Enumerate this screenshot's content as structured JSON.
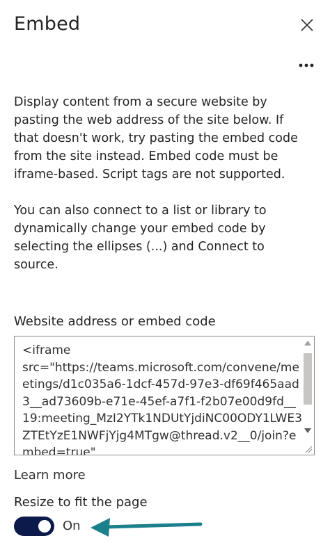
{
  "panel": {
    "title": "Embed",
    "close_icon": "close-icon",
    "more_icon": "more-options-icon"
  },
  "description": {
    "paragraph1": "Display content from a secure website by pasting the web address of the site below. If that doesn't work, try pasting the embed code from the site instead. Embed code must be iframe-based. Script tags are not supported.",
    "paragraph2": "You can also connect to a list or library to dynamically change your embed code by selecting the ellipses (...) and Connect to source."
  },
  "embed_field": {
    "label": "Website address or embed code",
    "value": "<iframe\nsrc=\"https://teams.microsoft.com/convene/meetings/d1c035a6-1dcf-457d-97e3-df69f465aad3__ad73609b-e71e-45ef-a7f1-f2b07e00d9fd__19:meeting_MzI2YTk1NDUtYjdiNC00ODY1LWE3ZTEtYzE1NWFjYjg4MTgw@thread.v2__0/join?embed=true\""
  },
  "learn_more": {
    "label": "Learn more"
  },
  "resize": {
    "label": "Resize to fit the page",
    "state_label": "On",
    "enabled": true
  },
  "colors": {
    "toggle_on": "#0b1a4a",
    "callout_arrow": "#1b7f8c"
  }
}
